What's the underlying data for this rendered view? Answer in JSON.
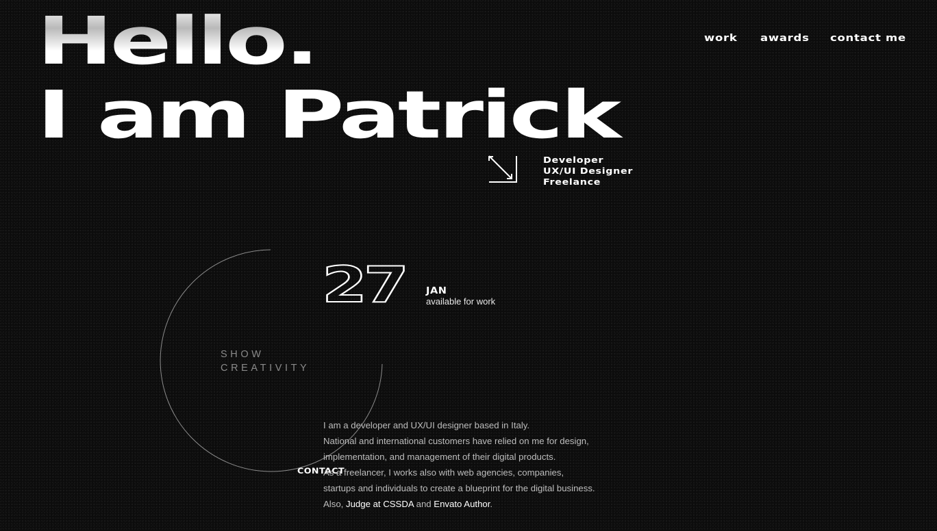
{
  "hero": {
    "line1": "Hello.",
    "line2": "I am Patrick"
  },
  "nav": {
    "items": [
      {
        "label": "work"
      },
      {
        "label": "awards"
      },
      {
        "label": "contact me"
      }
    ]
  },
  "roles": [
    "Developer",
    "UX/UI Designer",
    "Freelance"
  ],
  "icons": {
    "arrow": "arrow-down-right-icon"
  },
  "circle_label": {
    "line1": "SHOW",
    "line2": "CREATIVITY"
  },
  "availability": {
    "day": "27",
    "month": "JAN",
    "text": "available for work"
  },
  "bio": {
    "line1": "I am a developer and UX/UI designer based in Italy.",
    "line2": "National and international customers have relied on me for design,",
    "line3": "implementation, and management of their digital products.",
    "line4": "As a freelancer, I works also with web agencies, companies,",
    "line5": "startups and individuals to create a blueprint for the digital business.",
    "line6_prefix": "Also, ",
    "judge": "Judge at CSSDA",
    "and": " and ",
    "envato": "Envato Author",
    "period": "."
  },
  "contact_label": "CONTACT",
  "colors": {
    "background": "#0c0c0c",
    "text": "#ffffff",
    "muted": "#bdbdbd",
    "circle_label": "#8a8a8a"
  }
}
